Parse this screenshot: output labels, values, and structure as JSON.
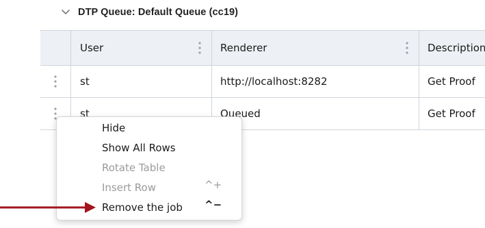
{
  "section": {
    "title": "DTP Queue: Default Queue (cc19)"
  },
  "table": {
    "headers": [
      "User",
      "Renderer",
      "Description"
    ],
    "rows": [
      [
        "st",
        "http://localhost:8282",
        "Get Proof"
      ],
      [
        "st",
        "Queued",
        "Get Proof"
      ]
    ]
  },
  "context_menu": {
    "items": [
      {
        "label": "Hide",
        "enabled": true,
        "shortcut": ""
      },
      {
        "label": "Show All Rows",
        "enabled": true,
        "shortcut": ""
      },
      {
        "label": "Rotate Table",
        "enabled": false,
        "shortcut": ""
      },
      {
        "label": "Insert Row",
        "enabled": false,
        "shortcut": "^+"
      },
      {
        "label": "Remove the job",
        "enabled": true,
        "shortcut": "^−"
      }
    ]
  },
  "colors": {
    "header_bg": "#edf1f5",
    "grid_line": "#cfd5db",
    "arrow": "#a3141c",
    "disabled_text": "#9a9a9a"
  },
  "icons": [
    "chevron-down-icon",
    "kebab-icon",
    "arrow-right-icon"
  ]
}
